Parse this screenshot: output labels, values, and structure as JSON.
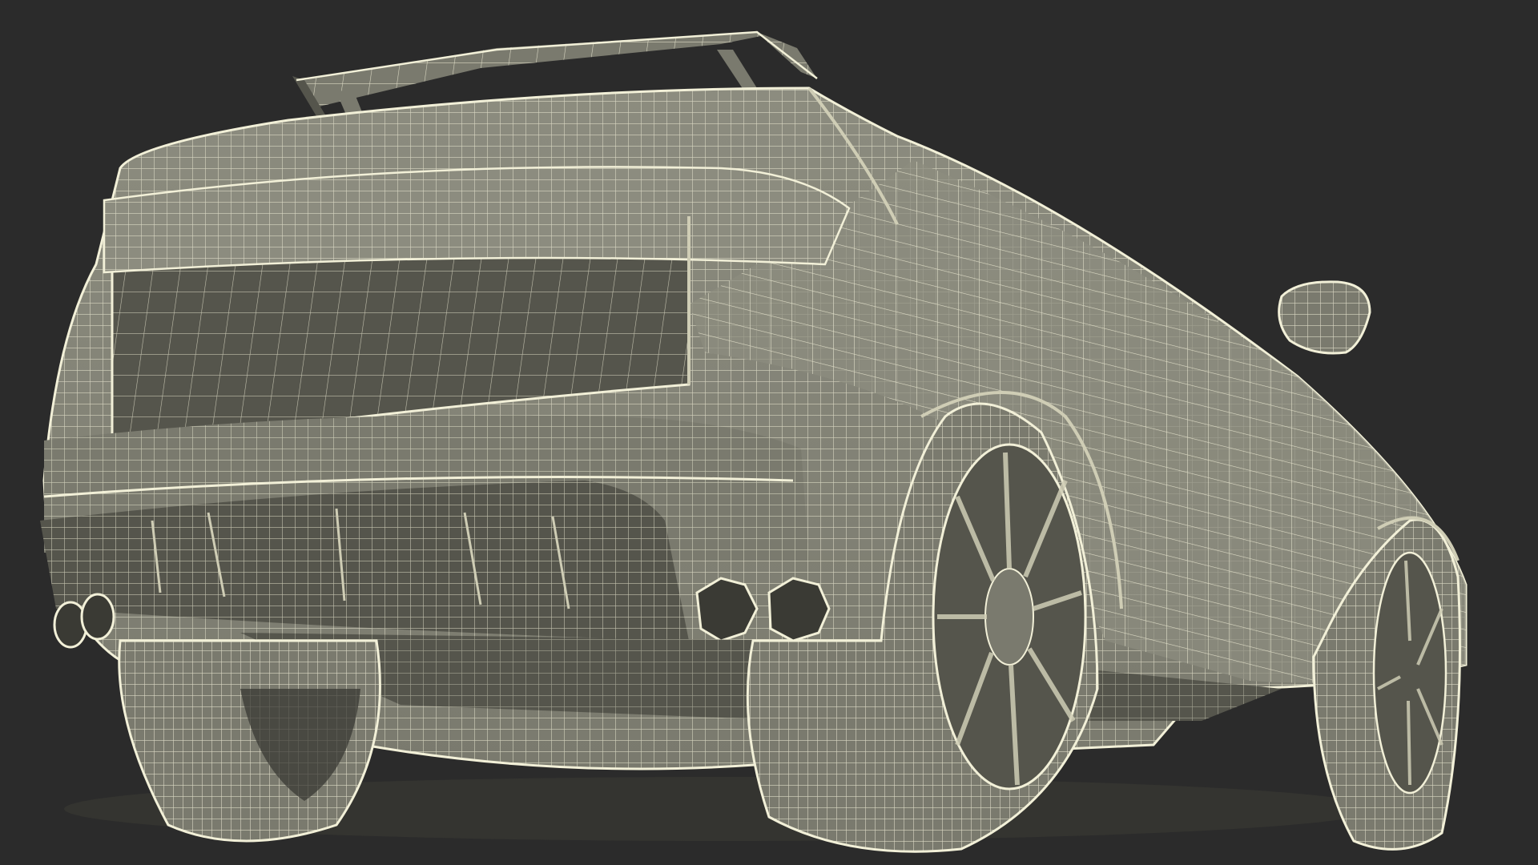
{
  "scene": {
    "background_color": "#2b2b2b",
    "surface_color": "#7a7a6e",
    "surface_shadow_color": "#55554c",
    "surface_light_color": "#8c8c7f",
    "wire_color": "#f2f0d8",
    "wire_dim_color": "#cfcdb5",
    "dark_color": "#3a3a34"
  }
}
